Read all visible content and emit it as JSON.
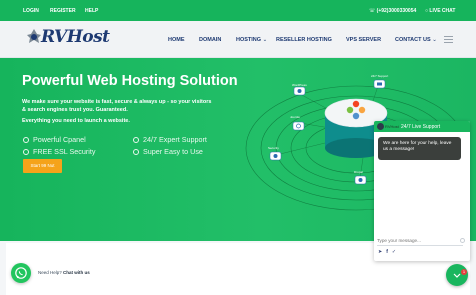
{
  "topbar": {
    "login": "LOGIN",
    "register": "REGISTER",
    "help": "HELP",
    "phone": "(+92)3000330054",
    "live_chat": "LIVE CHAT"
  },
  "brand": {
    "logo_text": "RVHost"
  },
  "nav": {
    "home": "HOME",
    "domain": "DOMAIN",
    "hosting": "HOSTING",
    "reseller": "RESELLER HOSTING",
    "vps": "VPS SERVER",
    "contact": "CONTACT US"
  },
  "hero": {
    "title": "Powerful Web Hosting Solution",
    "subtitle": "We make sure your website is fast, secure & always up - so your visitors & search engines trust you. Guaranteed.",
    "subtitle2": "Everything you need to launch a website.",
    "features": [
      "Powerful Cpanel",
      "24/7 Expert Support",
      "FREE SSL Security",
      "Super Easy to Use"
    ],
    "cta": "Start 99 Nut"
  },
  "illustration": {
    "labels": {
      "wordpress": "WordPress",
      "support": "24/7 Support",
      "joomla": "Joomla",
      "security": "Security",
      "drupal": "Drupal",
      "database": "Database"
    }
  },
  "whatsapp": {
    "need_help": "Need Help?",
    "chat_with_us": "Chat with us"
  },
  "chat": {
    "agent": "RVHost",
    "header": "24/7 Live Support",
    "message": "We are here for your help, leave us a message!",
    "placeholder": "Type your message...",
    "badge": "1"
  },
  "colors": {
    "primary": "#16b45c",
    "nav_text": "#1e3a72",
    "cta": "#f5a31a"
  },
  "icons": [
    "phone-icon",
    "chat-icon",
    "hamburger-icon",
    "whatsapp-icon",
    "check-icon",
    "joomla-icon",
    "attachment-icon",
    "facebook-icon",
    "twitter-icon",
    "emoji-icon",
    "chevron-down-icon"
  ]
}
